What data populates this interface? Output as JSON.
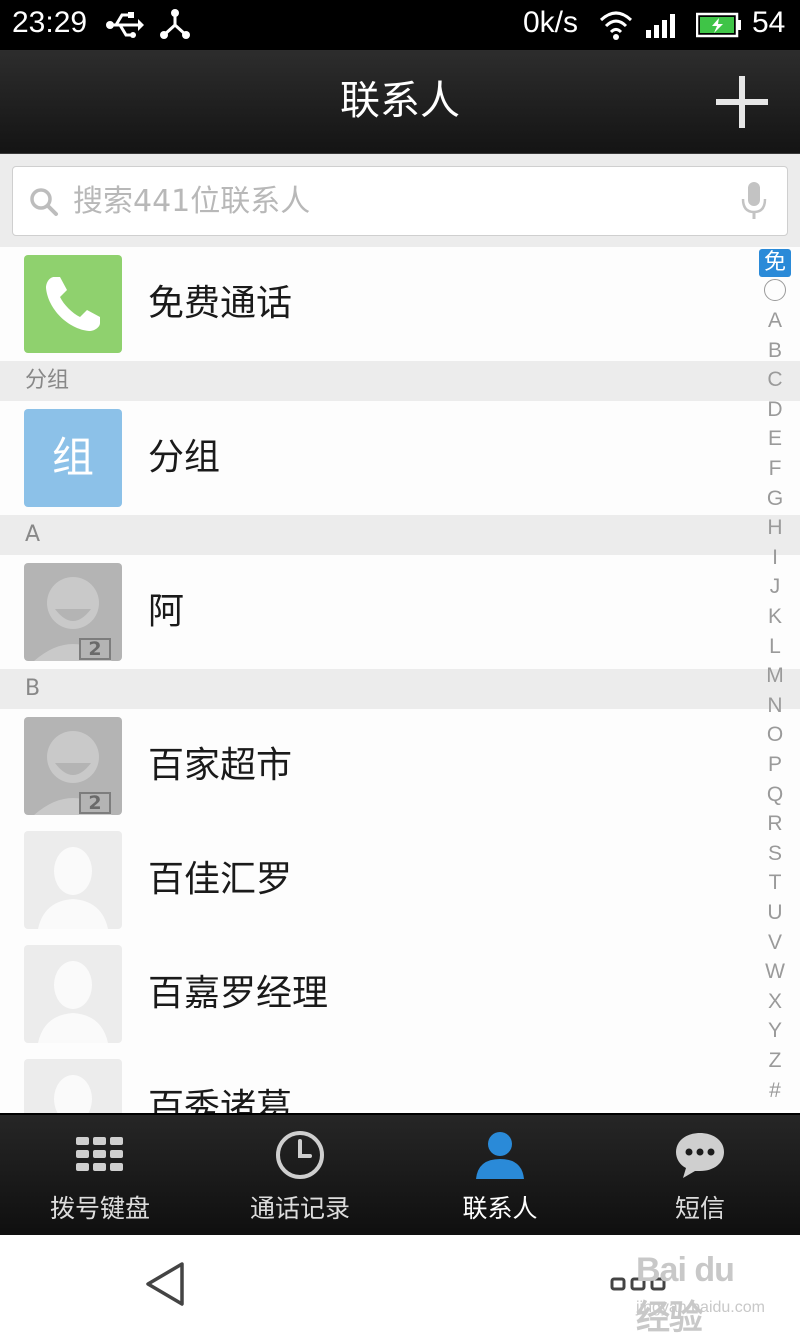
{
  "status_bar": {
    "time": "23:29",
    "net_speed": "0k/s",
    "battery": "54",
    "icons": [
      "usb-icon",
      "share-icon",
      "wifi-icon",
      "signal-icon",
      "battery-icon"
    ]
  },
  "header": {
    "title": "联系人",
    "add_icon": "plus-icon"
  },
  "search": {
    "placeholder": "搜索441位联系人",
    "value": "",
    "mic_icon": "mic-icon"
  },
  "list": {
    "free_call": {
      "label": "免费通话",
      "icon": "phone-icon",
      "color": "#8fd16e"
    },
    "sections": [
      {
        "header": "分组",
        "items": [
          {
            "label": "分组",
            "avatar_text": "组",
            "color": "#8cc1e8"
          }
        ]
      },
      {
        "header": "A",
        "items": [
          {
            "label": "阿",
            "badge": "2"
          }
        ]
      },
      {
        "header": "B",
        "items": [
          {
            "label": "百家超市",
            "badge": "2"
          },
          {
            "label": "百佳汇罗"
          },
          {
            "label": "百嘉罗经理"
          },
          {
            "label": "百秀诸葛"
          }
        ]
      }
    ]
  },
  "index": {
    "free": "免",
    "letters": [
      "A",
      "B",
      "C",
      "D",
      "E",
      "F",
      "G",
      "H",
      "I",
      "J",
      "K",
      "L",
      "M",
      "N",
      "O",
      "P",
      "Q",
      "R",
      "S",
      "T",
      "U",
      "V",
      "W",
      "X",
      "Y",
      "Z",
      "#"
    ]
  },
  "tabs": [
    {
      "label": "拨号键盘",
      "icon": "dialpad-icon",
      "active": false
    },
    {
      "label": "通话记录",
      "icon": "clock-icon",
      "active": false
    },
    {
      "label": "联系人",
      "icon": "person-icon",
      "active": true
    },
    {
      "label": "短信",
      "icon": "chat-icon",
      "active": false
    }
  ],
  "colors": {
    "accent": "#2a8ad8",
    "free_call": "#8fd16e",
    "group": "#8cc1e8"
  },
  "watermark": {
    "brand": "Bai du 经验",
    "url": "jingyan.baidu.com"
  }
}
